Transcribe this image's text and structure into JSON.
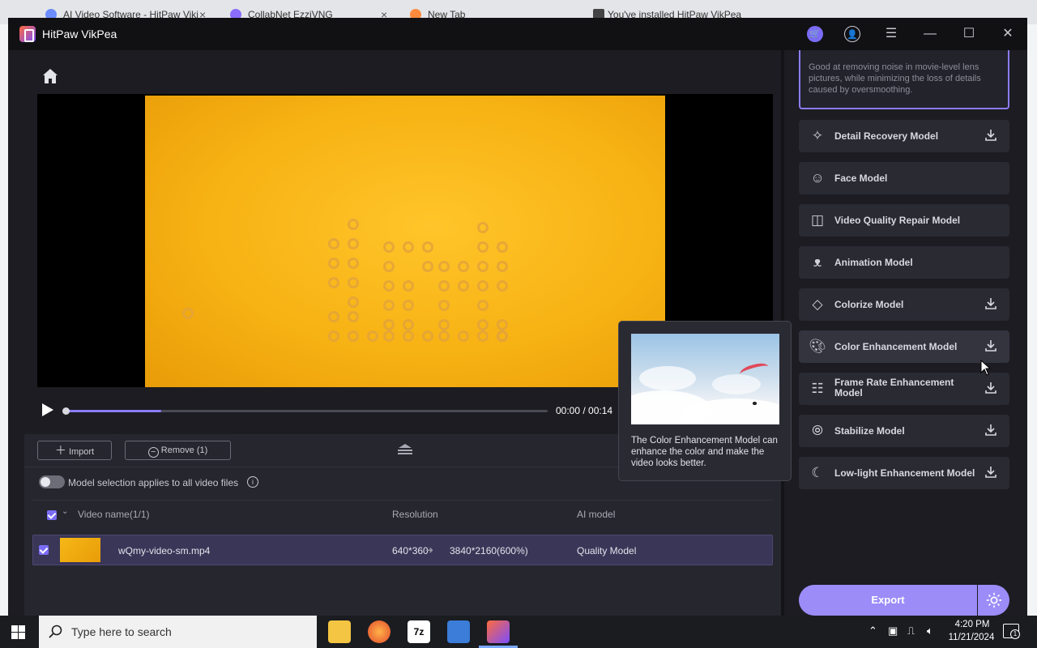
{
  "browser": {
    "tabs": [
      {
        "label": "AI Video Software - HitPaw Viki"
      },
      {
        "label": "CollabNet EzziVNG"
      },
      {
        "label": "New Tab"
      },
      {
        "label": "You've installed HitPaw VikPea"
      }
    ]
  },
  "app": {
    "title": "HitPaw VikPea"
  },
  "player": {
    "timecode": "00:00 / 00:14",
    "progress": 0.2
  },
  "files": {
    "import_label": "Import",
    "remove_label": "Remove (1)",
    "toggle_label": "Model selection applies to all video files",
    "columns": {
      "name": "Video name(1/1)",
      "resolution": "Resolution",
      "model": "AI model"
    },
    "rows": [
      {
        "name": "wQmy-video-sm.mp4",
        "res_from": "640*360",
        "res_to": "3840*2160(600%)",
        "model": "Quality Model"
      }
    ]
  },
  "models": {
    "description": "Good at removing noise in movie-level lens pictures, while minimizing the loss of details caused by oversmoothing.",
    "items": [
      {
        "label": "Detail Recovery Model"
      },
      {
        "label": "Face Model"
      },
      {
        "label": "Video Quality Repair Model"
      },
      {
        "label": "Animation Model"
      },
      {
        "label": "Colorize Model"
      },
      {
        "label": "Color Enhancement Model"
      },
      {
        "label": "Frame Rate Enhancement Model"
      },
      {
        "label": "Stabilize Model"
      },
      {
        "label": "Low-light Enhancement Model"
      }
    ],
    "export_label": "Export"
  },
  "tooltip": {
    "text": "The Color Enhancement Model can enhance the color and make the video looks better."
  },
  "taskbar": {
    "search_placeholder": "Type here to search",
    "time": "4:20 PM",
    "date": "11/21/2024",
    "notification_count": "1"
  }
}
